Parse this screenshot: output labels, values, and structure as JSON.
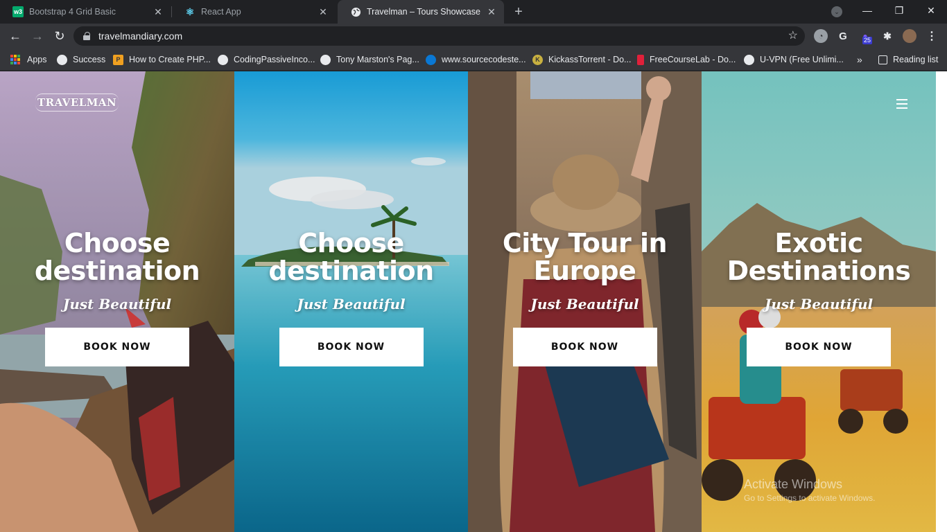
{
  "browser": {
    "tabs": [
      {
        "title": "Bootstrap 4 Grid Basic",
        "favicon_text": "w3",
        "favicon_color": "#04aa6d"
      },
      {
        "title": "React App",
        "favicon_text": "⚛",
        "favicon_color": "#61dafb"
      },
      {
        "title": "Travelman – Tours Showcase",
        "favicon_text": "",
        "favicon_color": "#e8eaed"
      }
    ],
    "new_tab_symbol": "+",
    "window_controls": {
      "minimize": "—",
      "restore": "❐",
      "close": "✕"
    },
    "url": "travelmandiary.com",
    "extension_badge": "25"
  },
  "bookmarks": [
    {
      "label": "Apps",
      "icon": "apps-grid-icon"
    },
    {
      "label": "Success",
      "icon": "globe-icon"
    },
    {
      "label": "How to Create PHP...",
      "icon": "p-logo-icon"
    },
    {
      "label": "CodingPassiveInco...",
      "icon": "globe-icon"
    },
    {
      "label": "Tony Marston's Pag...",
      "icon": "globe-icon"
    },
    {
      "label": "www.sourcecodeste...",
      "icon": "drop-icon"
    },
    {
      "label": "KickassTorrent - Do...",
      "icon": "k-logo-icon"
    },
    {
      "label": "FreeCourseLab - Do...",
      "icon": "bookmark-red-icon"
    },
    {
      "label": "U-VPN (Free Unlimi...",
      "icon": "globe-icon"
    },
    {
      "label": "Reading list",
      "icon": "reading-list-icon"
    }
  ],
  "site": {
    "logo_text": "TRAVELMAN",
    "panels": [
      {
        "title_line1": "Choose",
        "title_line2": "destination",
        "subtitle": "Just Beautiful",
        "button": "BOOK NOW"
      },
      {
        "title_line1": "Choose",
        "title_line2": "destination",
        "subtitle": "Just Beautiful",
        "button": "BOOK NOW"
      },
      {
        "title_line1": "City Tour in",
        "title_line2": "Europe",
        "subtitle": "Just Beautiful",
        "button": "BOOK NOW"
      },
      {
        "title_line1": "Exotic",
        "title_line2": "Destinations",
        "subtitle": "Just Beautiful",
        "button": "BOOK NOW"
      }
    ]
  },
  "watermark": {
    "line1": "Activate Windows",
    "line2": "Go to Settings to activate Windows."
  },
  "colors": {
    "chrome_dark": "#202124",
    "chrome_toolbar": "#35363a",
    "button_bg": "#ffffff"
  }
}
